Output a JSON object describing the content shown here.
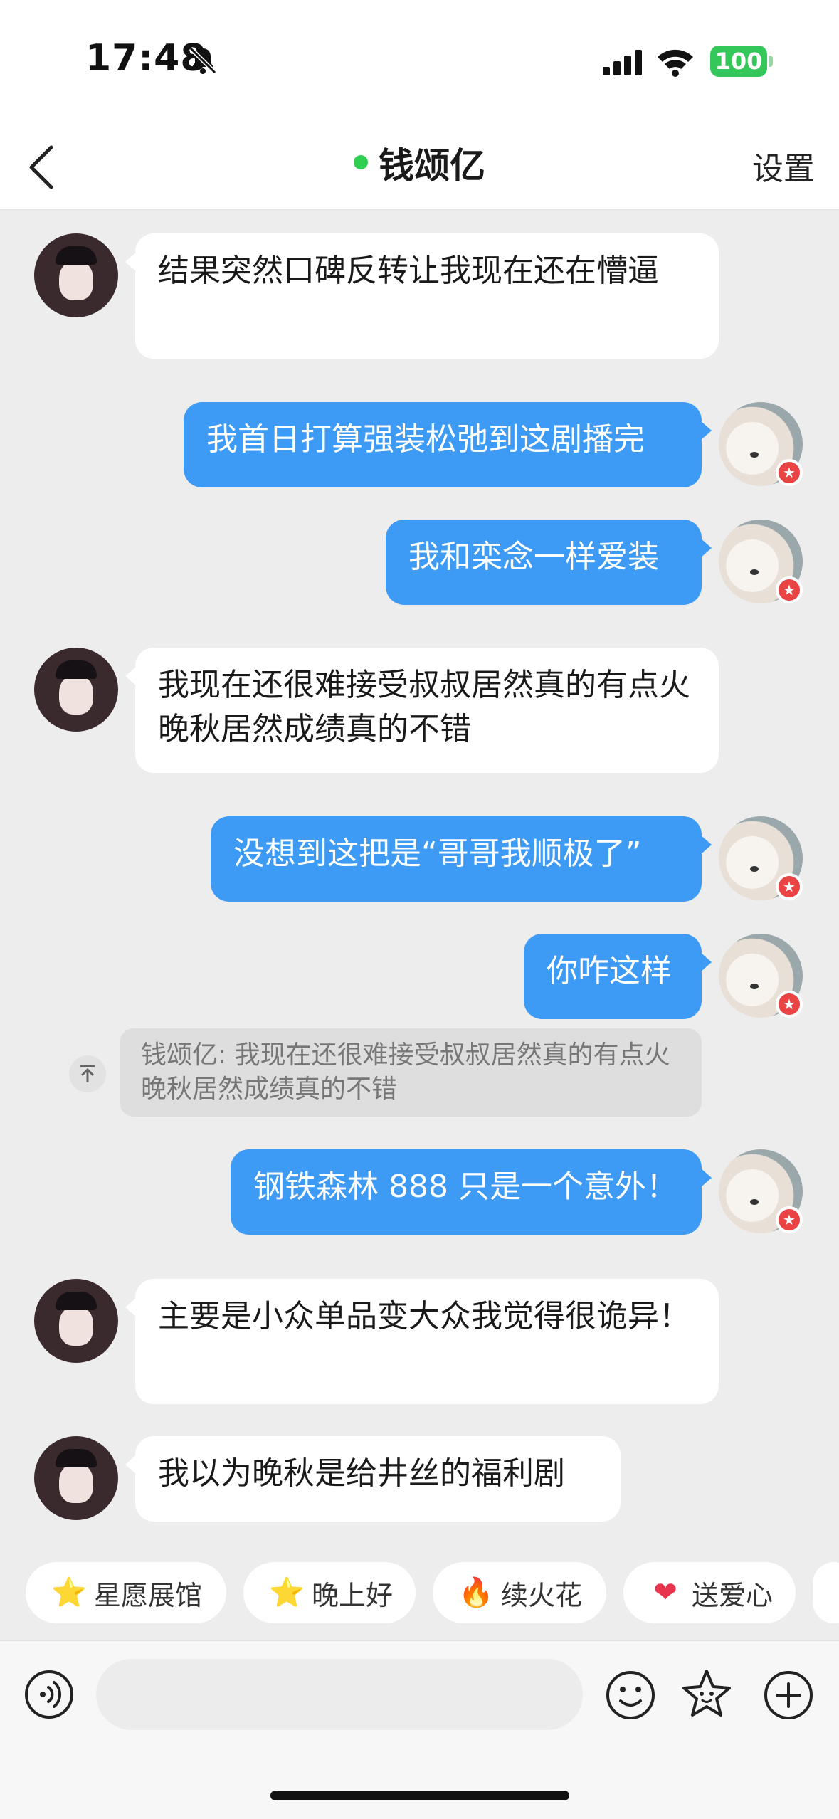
{
  "status_bar": {
    "time": "17:48",
    "battery": "100"
  },
  "header": {
    "title": "钱颂亿",
    "settings_label": "设置"
  },
  "messages": [
    {
      "from": "them",
      "text": "结果突然口碑反转让我现在还在懵逼"
    },
    {
      "from": "me",
      "text": "我首日打算强装松弛到这剧播完"
    },
    {
      "from": "me",
      "text": "我和栾念一样爱装"
    },
    {
      "from": "them",
      "text": "我现在还很难接受叔叔居然真的有点火晚秋居然成绩真的不错"
    },
    {
      "from": "me",
      "text": "没想到这把是“哥哥我顺极了”"
    },
    {
      "from": "me",
      "text": "你咋这样"
    },
    {
      "from": "me",
      "text": "钢铁森林 888 只是一个意外！"
    },
    {
      "from": "them",
      "text": "主要是小众单品变大众我觉得很诡异！"
    },
    {
      "from": "them",
      "text": "我以为晚秋是给井丝的福利剧"
    }
  ],
  "quote": {
    "text": "钱颂亿: 我现在还很难接受叔叔居然真的有点火晚秋居然成绩真的不错"
  },
  "quick_actions": [
    {
      "label": "星愿展馆",
      "icon": "star-face-icon"
    },
    {
      "label": "晚上好",
      "icon": "star-face-icon"
    },
    {
      "label": "续火花",
      "icon": "fire-icon"
    },
    {
      "label": "送爱心",
      "icon": "heart-icon"
    }
  ],
  "input": {
    "value": "",
    "placeholder": ""
  },
  "colors": {
    "outgoing_bubble": "#3d9bf5",
    "incoming_bubble": "#ffffff",
    "online_dot": "#2fcf51",
    "background": "#ededed"
  }
}
